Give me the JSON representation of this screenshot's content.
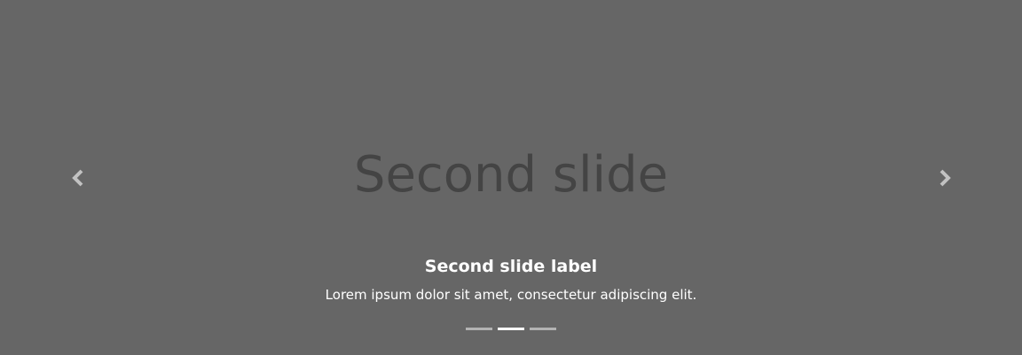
{
  "slide": {
    "placeholder_text": "Second slide",
    "caption_title": "Second slide label",
    "caption_text": "Lorem ipsum dolor sit amet, consectetur adipiscing elit."
  },
  "controls": {
    "prev_icon": "chevron-left-icon",
    "next_icon": "chevron-right-icon"
  },
  "indicators": {
    "count": 3,
    "active_index": 1
  },
  "colors": {
    "background": "#666666",
    "placeholder_text": "#444444",
    "caption": "#ffffff"
  }
}
